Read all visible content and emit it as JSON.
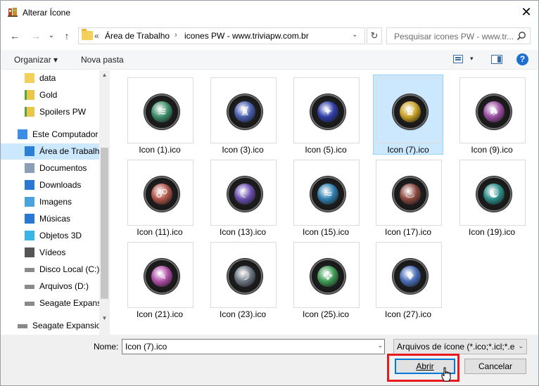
{
  "window": {
    "title": "Alterar Ícone",
    "close_glyph": "✕"
  },
  "nav": {
    "back_glyph": "←",
    "forward_glyph": "→",
    "recent_glyph": "⌄",
    "up_glyph": "↑",
    "address_overflow": "«",
    "breadcrumb": [
      "Área de Trabalho",
      "icones PW - www.triviapw.com.br"
    ],
    "breadcrumb_sep": "›",
    "address_dropdown": "⌄",
    "refresh_glyph": "↻",
    "search_placeholder": "Pesquisar icones PW - www.tr..."
  },
  "toolbar": {
    "organize_label": "Organizar ▾",
    "new_folder_label": "Nova pasta",
    "view_dropdown": "▾",
    "help_label": "?"
  },
  "sidebar": {
    "items": [
      {
        "label": "data",
        "icon": "folder-icon",
        "selected": false,
        "indent": 1
      },
      {
        "label": "Gold",
        "icon": "shortcut-icon",
        "selected": false,
        "indent": 1
      },
      {
        "label": "Spoilers PW",
        "icon": "shortcut-icon",
        "selected": false,
        "indent": 1
      },
      {
        "label": "Este Computador",
        "icon": "computer-icon",
        "selected": false,
        "indent": 0
      },
      {
        "label": "Área de Trabalho",
        "icon": "desktop-icon",
        "selected": true,
        "indent": 1
      },
      {
        "label": "Documentos",
        "icon": "documents-icon",
        "selected": false,
        "indent": 1
      },
      {
        "label": "Downloads",
        "icon": "downloads-icon",
        "selected": false,
        "indent": 1
      },
      {
        "label": "Imagens",
        "icon": "pictures-icon",
        "selected": false,
        "indent": 1
      },
      {
        "label": "Músicas",
        "icon": "music-icon",
        "selected": false,
        "indent": 1
      },
      {
        "label": "Objetos 3D",
        "icon": "objects-3d-icon",
        "selected": false,
        "indent": 1
      },
      {
        "label": "Vídeos",
        "icon": "videos-icon",
        "selected": false,
        "indent": 1
      },
      {
        "label": "Disco Local (C:)",
        "icon": "drive-icon",
        "selected": false,
        "indent": 1
      },
      {
        "label": "Arquivos (D:)",
        "icon": "drive-icon",
        "selected": false,
        "indent": 1
      },
      {
        "label": "Seagate Expansi",
        "icon": "drive-icon",
        "selected": false,
        "indent": 1
      },
      {
        "label": "Seagate Expansion",
        "icon": "drive-icon",
        "selected": false,
        "indent": 0
      }
    ],
    "expander_glyph": "⌄"
  },
  "files": [
    {
      "label": "Icon (1).ico",
      "color": "#3f8f6a",
      "glyph": "≋",
      "selected": false
    },
    {
      "label": "Icon (3).ico",
      "color": "#4a5fb0",
      "glyph": "♜",
      "selected": false
    },
    {
      "label": "Icon (5).ico",
      "color": "#2f3fa8",
      "glyph": "✦",
      "selected": false
    },
    {
      "label": "Icon (7).ico",
      "color": "#c9a227",
      "glyph": "♛",
      "selected": true
    },
    {
      "label": "Icon (9).ico",
      "color": "#9c4fa3",
      "glyph": "♠",
      "selected": false
    },
    {
      "label": "Icon (11).ico",
      "color": "#b0574a",
      "glyph": "☍",
      "selected": false
    },
    {
      "label": "Icon (13).ico",
      "color": "#6a4fae",
      "glyph": "☾",
      "selected": false
    },
    {
      "label": "Icon (15).ico",
      "color": "#2f7fae",
      "glyph": "≈",
      "selected": false
    },
    {
      "label": "Icon (17).ico",
      "color": "#8a4a3f",
      "glyph": "♨",
      "selected": false
    },
    {
      "label": "Icon (19).ico",
      "color": "#2d8f8a",
      "glyph": "☯",
      "selected": false
    },
    {
      "label": "Icon (21).ico",
      "color": "#b04fa8",
      "glyph": "✎",
      "selected": false
    },
    {
      "label": "Icon (23).ico",
      "color": "#6b7580",
      "glyph": "☽",
      "selected": false
    },
    {
      "label": "Icon (25).ico",
      "color": "#3f9a55",
      "glyph": "✥",
      "selected": false
    },
    {
      "label": "Icon (27).ico",
      "color": "#4a6fb8",
      "glyph": "♦",
      "selected": false
    }
  ],
  "footer": {
    "name_label": "Nome:",
    "name_value": "Icon (7).ico",
    "name_dropdown": "⌄",
    "filter_value": "Arquivos de ícone (*.ico;*.icl;*.e",
    "filter_dropdown": "⌄",
    "open_label": "Abrir",
    "cancel_label": "Cancelar"
  },
  "colors": {
    "accent": "#0078d7",
    "selection": "#cce8ff",
    "highlight": "#e8191f"
  }
}
